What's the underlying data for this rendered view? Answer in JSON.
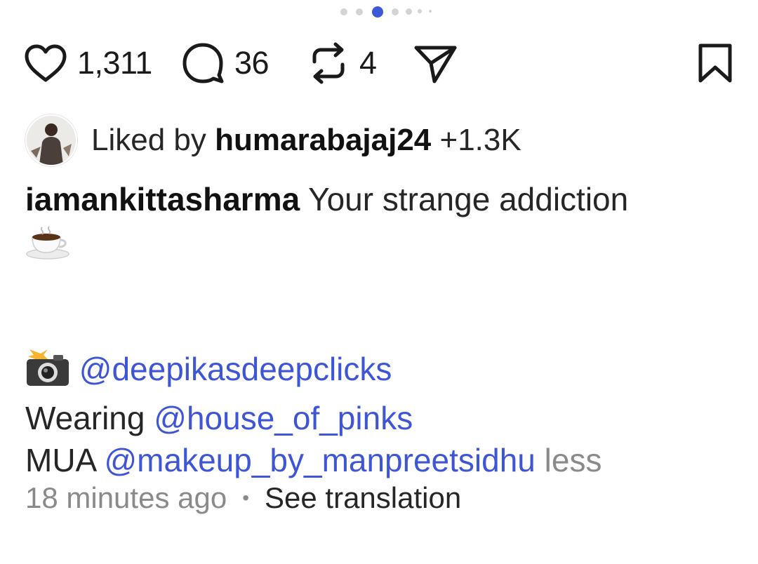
{
  "carousel": {
    "count": 7,
    "active_index": 2
  },
  "actions": {
    "likes": "1,311",
    "comments": "36",
    "reposts": "4"
  },
  "icons": {
    "like": "heart-icon",
    "comment": "comment-bubble-icon",
    "repost": "repost-icon",
    "share": "send-icon",
    "save": "bookmark-icon"
  },
  "liked_by": {
    "prefix": "Liked by",
    "username": "humarabajaj24",
    "others": "+1.3K"
  },
  "caption": {
    "username": "iamankittasharma",
    "text": "Your strange addiction",
    "line1_emoji": "☕",
    "camera_emoji": "📸",
    "photographer": "@deepikasdeepclicks",
    "wearing_label": "Wearing",
    "wearing_handle": "@house_of_pinks",
    "mua_label": "MUA",
    "mua_handle": "@makeup_by_manpreetsidhu",
    "less_label": "less"
  },
  "meta": {
    "time": "18 minutes ago",
    "separator": "•",
    "translate": "See translation"
  },
  "colors": {
    "accent": "#3e56d6",
    "text": "#262626",
    "muted": "#8a8a8a",
    "dot": "#d3d4d8",
    "dot_active": "#3b59d8"
  }
}
